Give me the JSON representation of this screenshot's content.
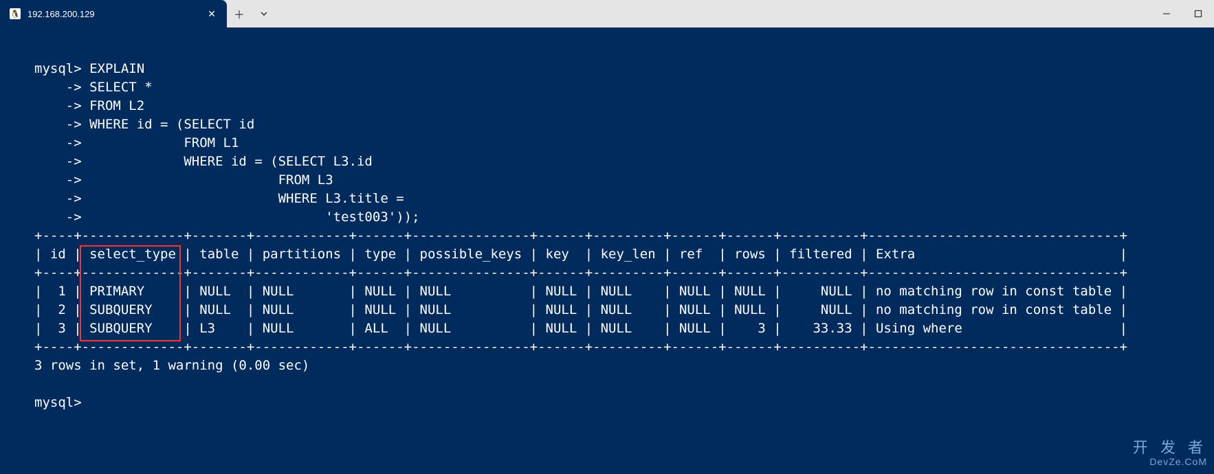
{
  "titlebar": {
    "tab_title": "192.168.200.129",
    "favicon_glyph": "🐧"
  },
  "terminal": {
    "prompt": "mysql>",
    "continuation": "    ->",
    "query_lines": [
      "mysql> EXPLAIN",
      "    -> SELECT *",
      "    -> FROM L2",
      "    -> WHERE id = (SELECT id",
      "    ->             FROM L1",
      "    ->             WHERE id = (SELECT L3.id",
      "    ->                         FROM L3",
      "    ->                         WHERE L3.title =",
      "    ->                               'test003'));"
    ],
    "table_border": "+----+-------------+-------+------------+------+---------------+------+---------+------+------+----------+--------------------------------+",
    "header_line": "| id | select_type | table | partitions | type | possible_keys | key  | key_len | ref  | rows | filtered | Extra                          |",
    "chart_data": {
      "type": "table",
      "columns": [
        "id",
        "select_type",
        "table",
        "partitions",
        "type",
        "possible_keys",
        "key",
        "key_len",
        "ref",
        "rows",
        "filtered",
        "Extra"
      ],
      "rows": [
        {
          "id": 1,
          "select_type": "PRIMARY",
          "table": "NULL",
          "partitions": "NULL",
          "type": "NULL",
          "possible_keys": "NULL",
          "key": "NULL",
          "key_len": "NULL",
          "ref": "NULL",
          "rows": "NULL",
          "filtered": "NULL",
          "Extra": "no matching row in const table"
        },
        {
          "id": 2,
          "select_type": "SUBQUERY",
          "table": "NULL",
          "partitions": "NULL",
          "type": "NULL",
          "possible_keys": "NULL",
          "key": "NULL",
          "key_len": "NULL",
          "ref": "NULL",
          "rows": "NULL",
          "filtered": "NULL",
          "Extra": "no matching row in const table"
        },
        {
          "id": 3,
          "select_type": "SUBQUERY",
          "table": "L3",
          "partitions": "NULL",
          "type": "ALL",
          "possible_keys": "NULL",
          "key": "NULL",
          "key_len": "NULL",
          "ref": "NULL",
          "rows": 3,
          "filtered": 33.33,
          "Extra": "Using where"
        }
      ]
    },
    "row_lines": [
      "|  1 | PRIMARY     | NULL  | NULL       | NULL | NULL          | NULL | NULL    | NULL | NULL |     NULL | no matching row in const table |",
      "|  2 | SUBQUERY    | NULL  | NULL       | NULL | NULL          | NULL | NULL    | NULL | NULL |     NULL | no matching row in const table |",
      "|  3 | SUBQUERY    | L3    | NULL       | ALL  | NULL          | NULL | NULL    | NULL |    3 |    33.33 | Using where                    |"
    ],
    "summary": "3 rows in set, 1 warning (0.00 sec)",
    "next_prompt": "mysql>"
  },
  "watermark": {
    "cn": "开 发 者",
    "en": "DevZe.CoM"
  }
}
